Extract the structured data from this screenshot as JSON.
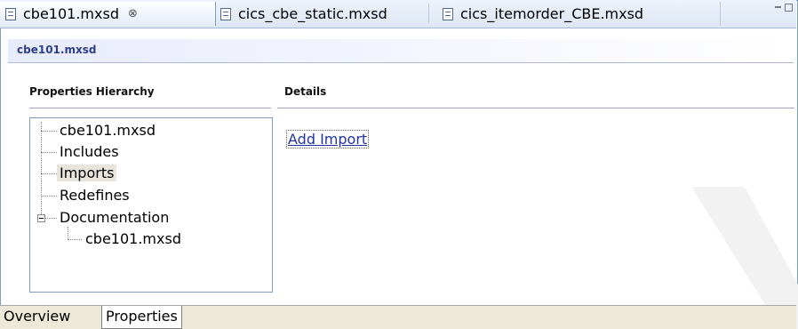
{
  "editor_tabs": [
    {
      "label": "cbe101.mxsd",
      "active": true,
      "close_glyph": "⊗"
    },
    {
      "label": "cics_cbe_static.mxsd",
      "active": false
    },
    {
      "label": "cics_itemorder_CBE.mxsd",
      "active": false
    }
  ],
  "form": {
    "title": "cbe101.mxsd"
  },
  "hierarchy": {
    "heading": "Properties Hierarchy",
    "nodes": [
      {
        "label": "cbe101.mxsd"
      },
      {
        "label": "Includes"
      },
      {
        "label": "Imports",
        "selected": true
      },
      {
        "label": "Redefines"
      },
      {
        "label": "Documentation",
        "expanded": true
      },
      {
        "label": "cbe101.mxsd",
        "child_of": "Documentation"
      }
    ]
  },
  "details": {
    "heading": "Details",
    "add_import_link": "Add Import"
  },
  "bottom_tabs": [
    {
      "label": "Overview",
      "active": false
    },
    {
      "label": "Properties",
      "active": true
    }
  ],
  "colors": {
    "form_title": "#2b3f8c",
    "link": "#2233aa",
    "selection": "#e9e5dc",
    "border": "#7f9db9"
  },
  "icons": [
    "document-icon",
    "close-icon",
    "minimize-icon",
    "maximize-icon",
    "collapse-icon"
  ]
}
